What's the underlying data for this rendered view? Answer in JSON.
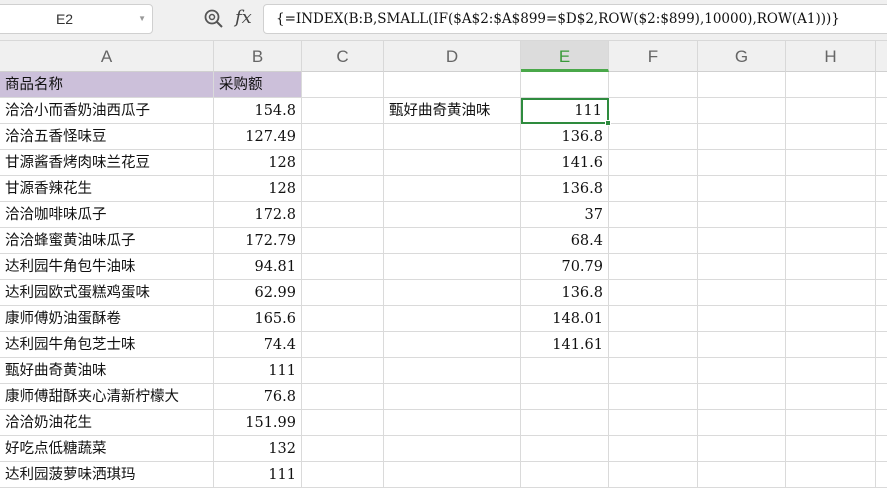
{
  "name_box": "E2",
  "formula": "{=INDEX(B:B,SMALL(IF($A$2:$A$899=$D$2,ROW($2:$899),10000),ROW(A1)))}",
  "fx_label": "fx",
  "columns": [
    "A",
    "B",
    "C",
    "D",
    "E",
    "F",
    "G",
    "H"
  ],
  "selected_column": "E",
  "header": {
    "a": "商品名称",
    "b": "采购额"
  },
  "rows": [
    {
      "a": "洽洽小而香奶油西瓜子",
      "b": "154.8"
    },
    {
      "a": "洽洽五香怪味豆",
      "b": "127.49"
    },
    {
      "a": "甘源酱香烤肉味兰花豆",
      "b": "128"
    },
    {
      "a": "甘源香辣花生",
      "b": "128"
    },
    {
      "a": "洽洽咖啡味瓜子",
      "b": "172.8"
    },
    {
      "a": "洽洽蜂蜜黄油味瓜子",
      "b": "172.79"
    },
    {
      "a": "达利园牛角包牛油味",
      "b": "94.81"
    },
    {
      "a": "达利园欧式蛋糕鸡蛋味",
      "b": "62.99"
    },
    {
      "a": "康师傅奶油蛋酥卷",
      "b": "165.6"
    },
    {
      "a": "达利园牛角包芝士味",
      "b": "74.4"
    },
    {
      "a": "甄好曲奇黄油味",
      "b": "111"
    },
    {
      "a": "康师傅甜酥夹心清新柠檬大",
      "b": "76.8"
    },
    {
      "a": "洽洽奶油花生",
      "b": "151.99"
    },
    {
      "a": "好吃点低糖蔬菜",
      "b": "132"
    },
    {
      "a": "达利园菠萝味洒琪玛",
      "b": "111"
    }
  ],
  "lookup_key": "甄好曲奇黄油味",
  "results": [
    "111",
    "136.8",
    "141.6",
    "136.8",
    "37",
    "68.4",
    "70.79",
    "136.8",
    "148.01",
    "141.61"
  ]
}
